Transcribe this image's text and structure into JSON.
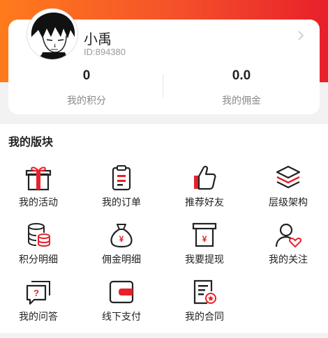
{
  "profile": {
    "name": "小禹",
    "id_text": "ID:894380"
  },
  "stats": [
    {
      "value": "0",
      "label": "我的积分"
    },
    {
      "value": "0.0",
      "label": "我的佣金"
    }
  ],
  "section": {
    "title": "我的版块",
    "items": [
      {
        "label": "我的活动",
        "icon": "gift-icon"
      },
      {
        "label": "我的订单",
        "icon": "clipboard-icon"
      },
      {
        "label": "推荐好友",
        "icon": "thumbs-up-icon"
      },
      {
        "label": "层级架构",
        "icon": "layers-icon"
      },
      {
        "label": "积分明细",
        "icon": "coin-stack-icon"
      },
      {
        "label": "佣金明细",
        "icon": "money-bag-icon"
      },
      {
        "label": "我要提现",
        "icon": "withdraw-icon"
      },
      {
        "label": "我的关注",
        "icon": "user-heart-icon"
      },
      {
        "label": "我的问答",
        "icon": "question-chat-icon"
      },
      {
        "label": "线下支付",
        "icon": "wallet-icon"
      },
      {
        "label": "我的合同",
        "icon": "contract-icon"
      }
    ]
  },
  "colors": {
    "accent": "#e8202a",
    "gradient_start": "#ff7b1c",
    "icon_dark": "#222222"
  }
}
